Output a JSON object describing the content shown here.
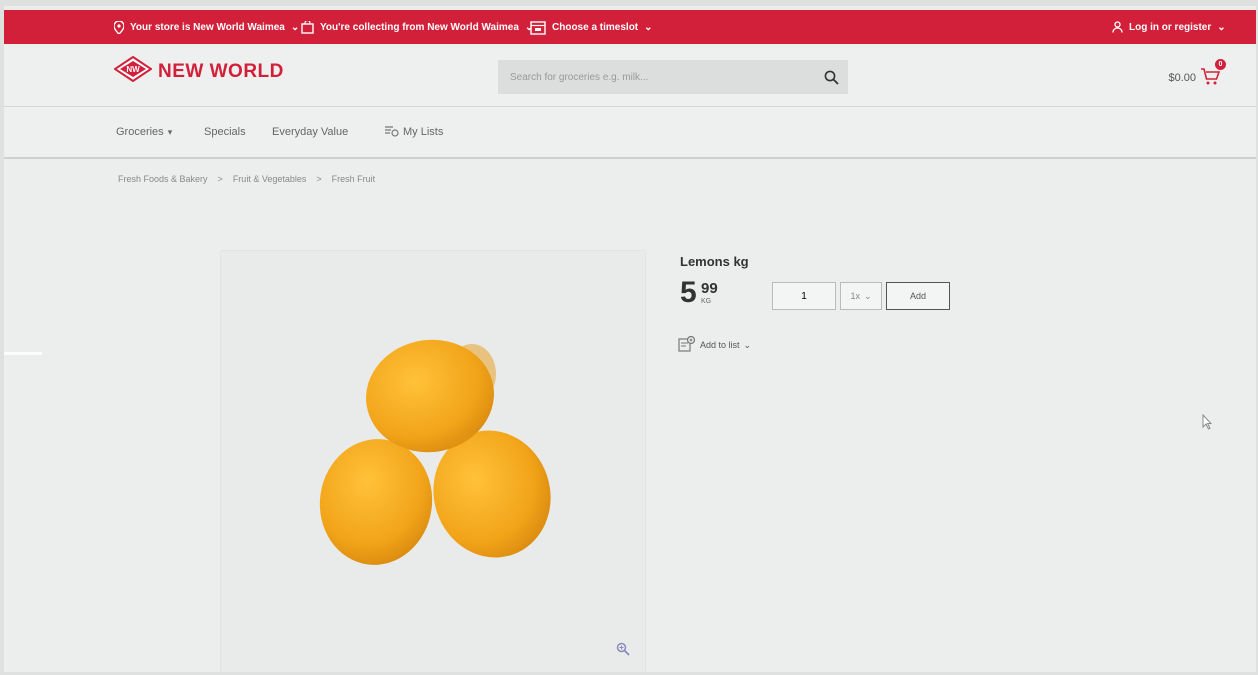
{
  "topbar": {
    "store_label": "Your store is New World Waimea",
    "collecting_label": "You're collecting from New World Waimea",
    "timeslot_label": "Choose a timeslot",
    "login_label": "Log in or register"
  },
  "header": {
    "logo_text": "NEW WORLD",
    "logo_badge": "NW",
    "search_placeholder": "Search for groceries e.g. milk...",
    "cart_total": "$0.00",
    "cart_count": "0"
  },
  "nav": {
    "groceries": "Groceries",
    "specials": "Specials",
    "everyday_value": "Everyday Value",
    "my_lists": "My Lists"
  },
  "breadcrumb": {
    "items": [
      "Fresh Foods & Bakery",
      "Fruit & Vegetables",
      "Fresh Fruit"
    ],
    "separator": ">"
  },
  "product": {
    "title": "Lemons kg",
    "price_dollars": "5",
    "price_cents": "99",
    "price_unit": "KG",
    "quantity": "1",
    "unit_option": "1x",
    "add_label": "Add",
    "add_to_list_label": "Add to list"
  },
  "colors": {
    "brand_red": "#d3203a",
    "lemon": "#f2a419"
  }
}
